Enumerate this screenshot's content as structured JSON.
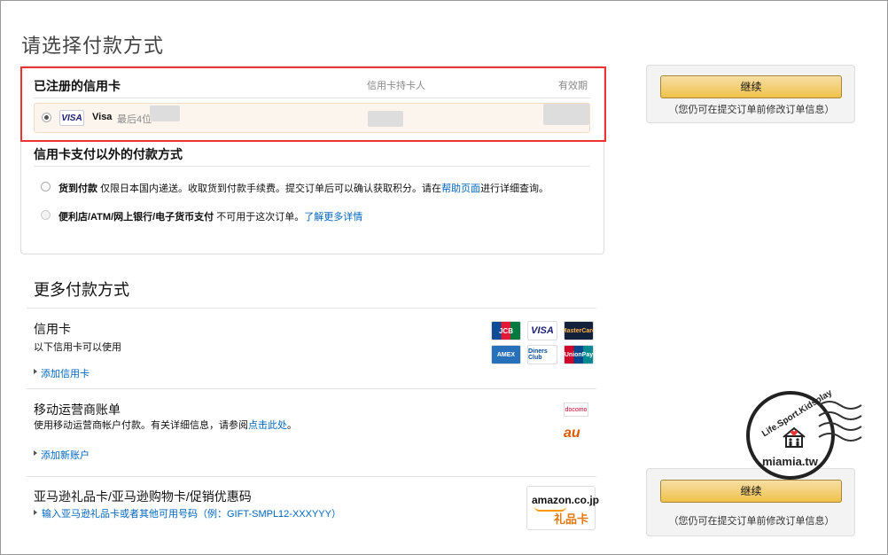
{
  "page": {
    "title": "请选择付款方式"
  },
  "registered": {
    "heading": "已注册的信用卡",
    "col_holder": "信用卡持卡人",
    "col_expiry": "有效期",
    "card": {
      "brand_logo": "VISA",
      "brand": "Visa",
      "last4_label": "最后4位"
    }
  },
  "other": {
    "heading": "信用卡支付以外的付款方式",
    "cod": {
      "title": "货到付款",
      "desc": "仅限日本国内递送。收取货到付款手续费。提交订单后可以确认获取积分。请在",
      "link": "帮助页面",
      "desc_after": "进行详细查询。"
    },
    "store": {
      "title": "便利店/ATM/网上银行/电子货币支付",
      "desc": "不可用于这次订单。",
      "link": "了解更多详情"
    }
  },
  "continue_top": {
    "button": "继续",
    "note": "（您仍可在提交订单前修改订单信息）"
  },
  "continue_bottom": {
    "button": "继续",
    "note": "（您仍可在提交订单前修改订单信息）"
  },
  "more": {
    "title": "更多付款方式",
    "credit": {
      "title": "信用卡",
      "desc": "以下信用卡可以使用",
      "add_link": "添加信用卡",
      "logos": [
        "JCB",
        "VISA",
        "MasterCard",
        "AMEX",
        "Diners Club",
        "UnionPay"
      ]
    },
    "mobile": {
      "title": "移动运营商账单",
      "desc": "使用移动运营商帐户付款。有关详细信息，请参阅",
      "link": "点击此处",
      "desc_after": "。",
      "add_link": "添加新账户",
      "logos": [
        "docomo",
        "au"
      ]
    },
    "gift": {
      "title": "亚马逊礼品卡/亚马逊购物卡/促销优惠码",
      "input_link": "输入亚马逊礼品卡或者其他可用号码（例：GIFT-SMPL12-XXXYYY）",
      "logo_text": "amazon.co.jp",
      "logo_sub": "礼品卡"
    }
  },
  "watermark": {
    "top": "Life.Sport.Kidsplay",
    "bottom": "miamia.tw"
  }
}
